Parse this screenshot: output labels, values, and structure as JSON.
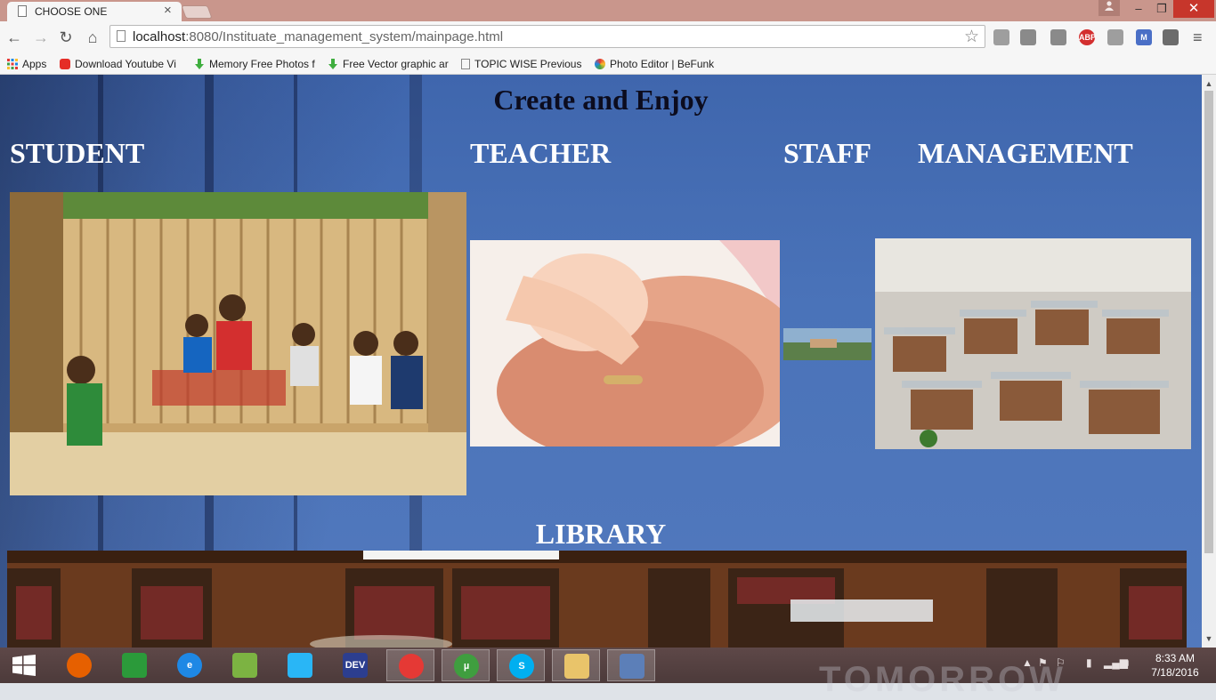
{
  "browser": {
    "tab_title": "CHOOSE ONE",
    "tab_close": "×",
    "profile_icon": "person-icon",
    "window_controls": {
      "minimize": "–",
      "maximize": "❐",
      "close": "✕"
    },
    "nav": {
      "back": "←",
      "forward": "→",
      "reload": "↻",
      "home": "⌂"
    },
    "url_host": "localhost",
    "url_rest": ":8080/Instituate_management_system/mainpage.html",
    "bookmark_star": "☆",
    "extensions": [
      {
        "name": "office-icon",
        "label": "",
        "color": "#9e9e9e"
      },
      {
        "name": "puzzle-icon",
        "label": "",
        "color": "#8a8a8a"
      },
      {
        "name": "puzzle-icon-2",
        "label": "",
        "color": "#8a8a8a"
      },
      {
        "name": "adblock-plus-icon",
        "label": "ABP",
        "color": "#d32f2f"
      },
      {
        "name": "circle-extension-icon",
        "label": "",
        "color": "#9e9e9e"
      },
      {
        "name": "gmail-icon",
        "label": "M",
        "color": "#4a6fc6"
      },
      {
        "name": "film-reel-icon",
        "label": "",
        "color": "#6c6c6c"
      }
    ],
    "menu": "≡"
  },
  "bookmarks": [
    {
      "label": "Apps",
      "icon": "apps-grid-icon"
    },
    {
      "label": "Download Youtube Vi",
      "icon": "youtube-icon"
    },
    {
      "label": "Memory Free Photos f",
      "icon": "download-arrow-icon"
    },
    {
      "label": "Free Vector graphic ar",
      "icon": "download-arrow-icon"
    },
    {
      "label": "TOPIC WISE Previous",
      "icon": "page-icon"
    },
    {
      "label": "Photo Editor | BeFunk",
      "icon": "befunky-icon"
    }
  ],
  "page": {
    "title": "Create and Enjoy",
    "categories": {
      "student": "STUDENT",
      "teacher": "TEACHER",
      "staff": "STAFF",
      "management": "MANAGEMENT",
      "library": "LIBRARY"
    }
  },
  "taskbar": {
    "apps": [
      {
        "name": "firefox-icon",
        "label": "",
        "color": "#e66000"
      },
      {
        "name": "store-icon",
        "label": "",
        "color": "#2b9a3a"
      },
      {
        "name": "internet-explorer-icon",
        "label": "e",
        "color": "#1e88e5"
      },
      {
        "name": "android-studio-icon",
        "label": "",
        "color": "#7cb342"
      },
      {
        "name": "shareit-icon",
        "label": "",
        "color": "#29b6f6"
      },
      {
        "name": "devcpp-icon",
        "label": "DEV",
        "color": "#2c3e8f"
      },
      {
        "name": "chrome-icon",
        "label": "",
        "color": "#e53935"
      },
      {
        "name": "utorrent-icon",
        "label": "µ",
        "color": "#3f9e3f"
      },
      {
        "name": "skype-icon",
        "label": "S",
        "color": "#00aff0"
      },
      {
        "name": "file-explorer-icon",
        "label": "",
        "color": "#e9c46a"
      },
      {
        "name": "virtualbox-icon",
        "label": "",
        "color": "#5c7fb8"
      }
    ],
    "time": "8:33 AM",
    "date": "7/18/2016",
    "watermark": "TOMORROW"
  }
}
